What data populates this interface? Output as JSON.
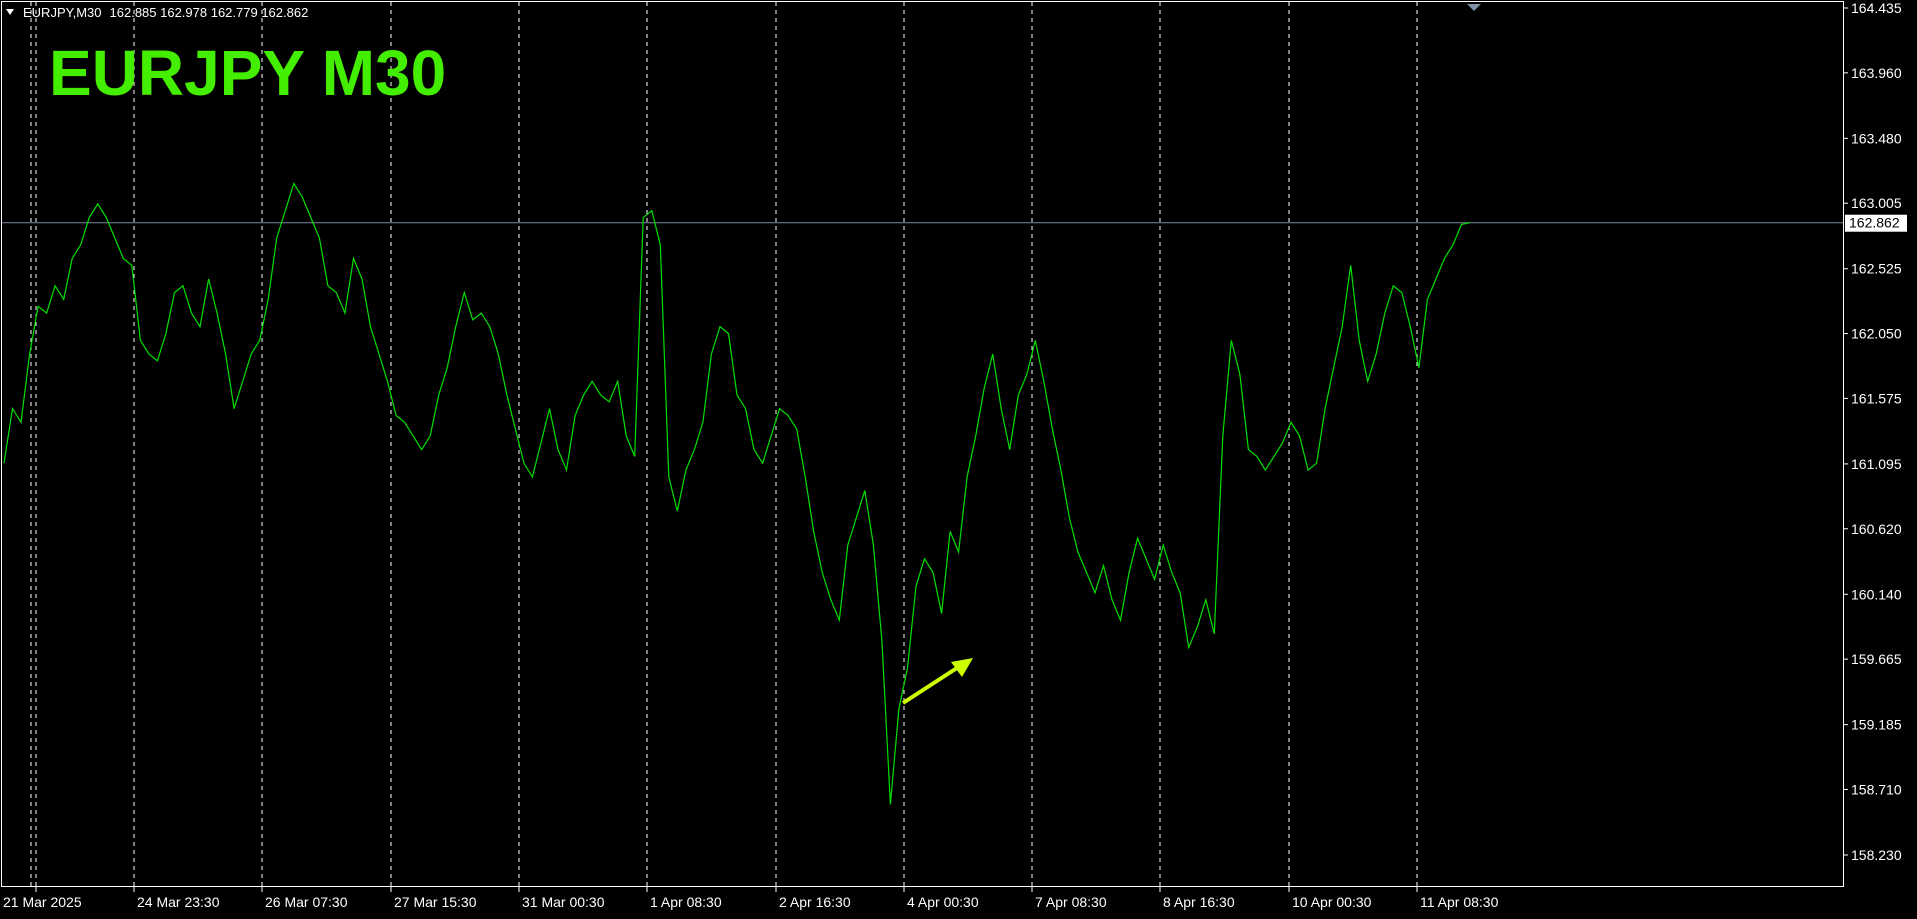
{
  "header": {
    "symbol_info": "EURJPY,M30",
    "ohlc": "162.885 162.978 162.779 162.862"
  },
  "overlay_title": "EURJPY  M30",
  "colors": {
    "background": "#000000",
    "price_line": "#00e000",
    "title": "#44ee00",
    "arrow": "#ccff00",
    "grid": "#ffffff",
    "current_price_line": "#7a8aa0",
    "axis_text": "#ffffff"
  },
  "current_price_label": "162.862",
  "chart_data": {
    "type": "line",
    "title": "EURJPY  M30",
    "xlabel": "",
    "ylabel": "",
    "ylim": [
      158.0,
      164.5
    ],
    "y_ticks": [
      "164.435",
      "163.960",
      "163.480",
      "163.005",
      "162.525",
      "162.050",
      "161.575",
      "161.095",
      "160.620",
      "160.140",
      "159.665",
      "159.185",
      "158.710",
      "158.230"
    ],
    "x_tick_labels": [
      "21 Mar 2025",
      "24 Mar 23:30",
      "26 Mar 07:30",
      "27 Mar 15:30",
      "31 Mar 00:30",
      "1 Apr 08:30",
      "2 Apr 16:30",
      "4 Apr 00:30",
      "7 Apr 08:30",
      "8 Apr 16:30",
      "10 Apr 00:30",
      "11 Apr 08:30"
    ],
    "grid": "vertical dashed",
    "current_price": 162.862,
    "annotation": "arrow pointing to the 7 Apr drop",
    "series": [
      {
        "values": [
          161.1,
          161.5,
          161.4,
          161.9,
          162.25,
          162.2,
          162.4,
          162.3,
          162.6,
          162.7,
          162.9,
          163.0,
          162.9,
          162.75,
          162.6,
          162.55,
          162.0,
          161.9,
          161.85,
          162.05,
          162.35,
          162.4,
          162.2,
          162.1,
          162.45,
          162.2,
          161.9,
          161.5,
          161.7,
          161.9,
          162.0,
          162.3,
          162.75,
          162.95,
          163.15,
          163.05,
          162.9,
          162.75,
          162.4,
          162.35,
          162.2,
          162.6,
          162.45,
          162.1,
          161.9,
          161.7,
          161.45,
          161.4,
          161.3,
          161.2,
          161.3,
          161.6,
          161.8,
          162.1,
          162.35,
          162.15,
          162.2,
          162.1,
          161.9,
          161.6,
          161.35,
          161.1,
          161.0,
          161.25,
          161.5,
          161.2,
          161.05,
          161.45,
          161.6,
          161.7,
          161.6,
          161.55,
          161.7,
          161.3,
          161.15,
          162.9,
          162.95,
          162.7,
          161.0,
          160.75,
          161.05,
          161.2,
          161.4,
          161.9,
          162.1,
          162.05,
          161.6,
          161.5,
          161.2,
          161.1,
          161.3,
          161.5,
          161.45,
          161.35,
          161.0,
          160.6,
          160.3,
          160.1,
          159.95,
          160.5,
          160.7,
          160.9,
          160.5,
          159.8,
          158.6,
          159.3,
          159.6,
          160.2,
          160.4,
          160.3,
          160.0,
          160.6,
          160.45,
          161.0,
          161.3,
          161.65,
          161.9,
          161.5,
          161.2,
          161.6,
          161.75,
          162.0,
          161.7,
          161.35,
          161.05,
          160.7,
          160.45,
          160.3,
          160.15,
          160.35,
          160.1,
          159.95,
          160.3,
          160.55,
          160.4,
          160.25,
          160.5,
          160.3,
          160.15,
          159.75,
          159.9,
          160.1,
          159.85,
          161.3,
          162.0,
          161.75,
          161.2,
          161.15,
          161.05,
          161.15,
          161.25,
          161.4,
          161.3,
          161.05,
          161.1,
          161.5,
          161.8,
          162.1,
          162.55,
          162.0,
          161.7,
          161.9,
          162.2,
          162.4,
          162.35,
          162.1,
          161.8,
          162.3,
          162.45,
          162.6,
          162.7,
          162.85,
          162.862
        ]
      }
    ]
  }
}
